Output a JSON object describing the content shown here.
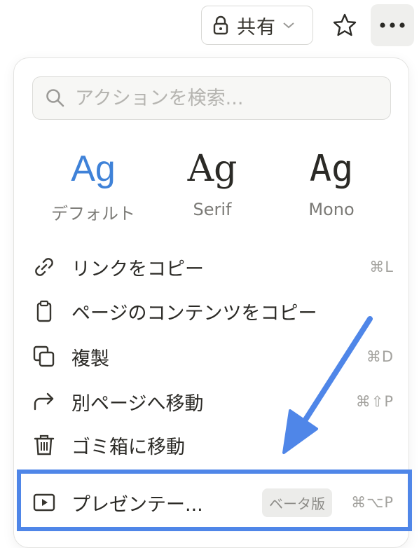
{
  "header": {
    "share_label": "共有",
    "icons": {
      "lock": "lock-icon",
      "chevron": "chevron-down-icon",
      "star": "star-icon",
      "more": "more-horizontal-icon"
    }
  },
  "menu": {
    "search": {
      "placeholder": "アクションを検索..."
    },
    "font_options": [
      {
        "sample": "Ag",
        "label": "デフォルト",
        "selected": true,
        "color": "#3f82d8"
      },
      {
        "sample": "Ag",
        "label": "Serif",
        "selected": false
      },
      {
        "sample": "Ag",
        "label": "Mono",
        "selected": false
      }
    ],
    "items": [
      {
        "label": "リンクをコピー",
        "shortcut": "⌘L",
        "icon": "link-icon"
      },
      {
        "label": "ページのコンテンツをコピー",
        "shortcut": "",
        "icon": "clipboard-icon"
      },
      {
        "label": "複製",
        "shortcut": "⌘D",
        "icon": "duplicate-icon"
      },
      {
        "label": "別ページへ移動",
        "shortcut": "⌘⇧P",
        "icon": "move-arrow-icon"
      },
      {
        "label": "ゴミ箱に移動",
        "shortcut": "",
        "icon": "trash-icon"
      },
      {
        "label": "プレゼンテー...",
        "shortcut": "⌘⌥P",
        "badge": "ベータ版",
        "icon": "play-icon"
      }
    ]
  },
  "annotation": {
    "color": "#4f86e8"
  }
}
